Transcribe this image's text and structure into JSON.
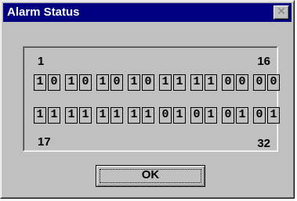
{
  "window": {
    "title": "Alarm Status",
    "close_glyph": "✕"
  },
  "labels": {
    "start_top": "1",
    "end_top": "16",
    "start_bottom": "17",
    "end_bottom": "32"
  },
  "bits_row_1": [
    "1",
    "0",
    "1",
    "0",
    "1",
    "0",
    "1",
    "0",
    "1",
    "1",
    "1",
    "1",
    "0",
    "0",
    "0",
    "0"
  ],
  "bits_row_2": [
    "1",
    "1",
    "1",
    "1",
    "1",
    "1",
    "1",
    "1",
    "0",
    "1",
    "0",
    "1",
    "0",
    "1",
    "0",
    "1"
  ],
  "buttons": {
    "ok_label": "OK"
  },
  "colors": {
    "face": "#c0c0c0",
    "title_bar": "#000080",
    "title_text": "#ffffff"
  }
}
